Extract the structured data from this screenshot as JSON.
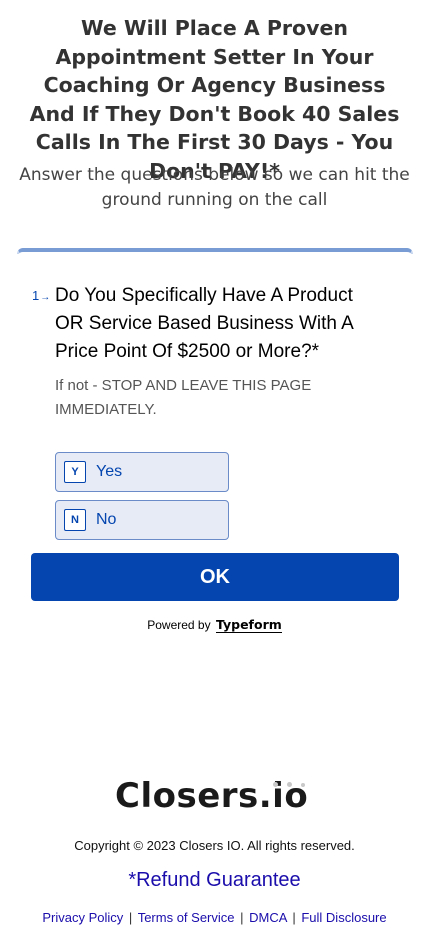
{
  "headline": "We Will Place A Proven Appointment Setter In Your Coaching Or Agency Business And If They Don't Book 40 Sales Calls In The First 30 Days - You Don't PAY!*",
  "subheadline": "Answer the questions below so we can hit the ground running on the call",
  "form": {
    "question_number": "1",
    "question_arrow": "→",
    "question_title": "Do You Specifically Have A Product OR Service Based Business With A Price Point Of $2500 or More?*",
    "question_description": "If not - STOP AND LEAVE THIS PAGE IMMEDIATELY.",
    "choices": [
      {
        "key": "Y",
        "label": "Yes"
      },
      {
        "key": "N",
        "label": "No"
      }
    ],
    "ok_label": "OK",
    "powered_by": "Powered by",
    "powered_brand": "Typeform",
    "accent_color": "#0445af"
  },
  "footer": {
    "logo_text": "Closers.io",
    "copyright": "Copyright © 2023 Closers IO. All rights reserved.",
    "refund_prefix": "*",
    "refund_link": "Refund Guarantee",
    "links": [
      "Privacy Policy",
      "Terms of Service",
      "DMCA",
      "Full Disclosure"
    ],
    "separator": "|"
  }
}
